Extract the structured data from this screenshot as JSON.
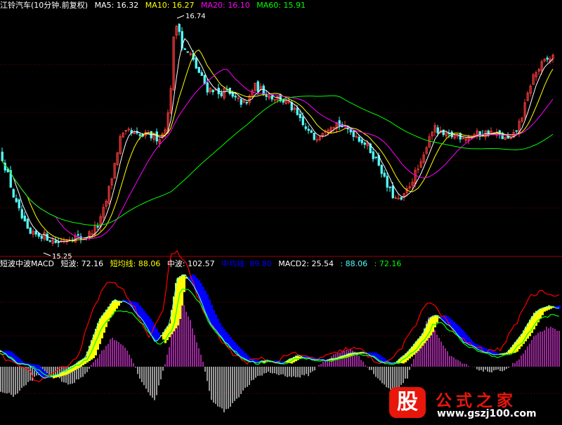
{
  "colors": {
    "background": "#000000",
    "candle_up": "#ff3c3c",
    "candle_down": "#54ffff",
    "ma5": "#ffffff",
    "ma10": "#ffff00",
    "ma20": "#ff00ff",
    "ma60": "#00ff00",
    "short_wave": "#ff0000",
    "short_avg": "#ffff00",
    "mid_wave": "#00ff00",
    "mid_avg": "#0000ff",
    "macd2": "#ffffff",
    "hist_pos": "#ff44ff",
    "hist_neg": "#ffffff",
    "grid": "#7a0000"
  },
  "price_panel": {
    "legend": [
      {
        "text": "江铃汽车(10分钟.前复权)",
        "color": "#ffffff"
      },
      {
        "text": "MA5: 16.32",
        "color": "#ffffff"
      },
      {
        "text": "MA10: 16.27",
        "color": "#ffff00"
      },
      {
        "text": "MA20: 16.10",
        "color": "#ff00ff"
      },
      {
        "text": "MA60: 15.91",
        "color": "#00ff00"
      }
    ],
    "high_label": "16.74",
    "low_label": "15.25"
  },
  "indicator_panel": {
    "legend": [
      {
        "text": "短波中波MACD",
        "color": "#ffffff"
      },
      {
        "text": "短波: 72.16",
        "color": "#ffffff"
      },
      {
        "text": "短均线: 88.06",
        "color": "#ffff00"
      },
      {
        "text": "中波: 102.57",
        "color": "#ffffff"
      },
      {
        "text": "中均线: 89.80",
        "color": "#0000ff"
      },
      {
        "text": "MACD2: 25.54",
        "color": "#ffffff"
      },
      {
        "text": ": 88.06",
        "color": "#54ffff"
      },
      {
        "text": ": 72.16",
        "color": "#00ff00"
      }
    ]
  },
  "watermark": {
    "logo": "股",
    "title": "公式之家",
    "url": "www.gszj100.com"
  },
  "chart_data": [
    {
      "type": "line",
      "title": "江铃汽车(10分钟.前复权)",
      "y_range": [
        15.25,
        16.74
      ],
      "price_anchors": {
        "x": [
          0,
          10,
          20,
          40,
          60,
          80,
          100,
          120,
          140,
          150,
          160,
          170,
          182,
          190,
          198,
          208,
          216,
          225,
          232,
          240,
          246,
          252,
          258,
          264,
          270,
          278,
          286,
          294,
          302,
          310,
          320,
          330,
          340,
          350,
          360,
          372,
          384,
          396,
          410,
          420,
          430,
          440,
          446,
          452,
          460,
          470,
          480,
          490,
          500,
          510,
          520,
          530,
          540,
          548,
          556,
          564,
          572,
          580,
          590,
          600,
          608,
          616,
          624,
          634,
          648,
          660,
          672,
          684,
          696,
          708,
          720,
          726,
          732,
          740,
          748,
          756,
          764,
          772,
          782,
          790
        ],
        "y": [
          15.86,
          15.72,
          15.55,
          15.33,
          15.33,
          15.28,
          15.32,
          15.31,
          15.4,
          15.55,
          15.75,
          15.96,
          16.0,
          15.98,
          15.97,
          15.98,
          15.97,
          15.96,
          16.0,
          16.15,
          16.6,
          16.74,
          16.55,
          16.52,
          16.5,
          16.42,
          16.35,
          16.28,
          16.28,
          16.25,
          16.27,
          16.22,
          16.2,
          16.18,
          16.3,
          16.27,
          16.23,
          16.22,
          16.18,
          16.12,
          16.04,
          15.99,
          15.96,
          15.98,
          16.02,
          16.05,
          16.06,
          16.02,
          16.0,
          15.96,
          15.92,
          15.85,
          15.78,
          15.66,
          15.6,
          15.55,
          15.56,
          15.64,
          15.73,
          15.8,
          15.96,
          16.03,
          15.99,
          15.97,
          15.98,
          15.97,
          15.98,
          15.99,
          16.0,
          15.98,
          15.95,
          15.95,
          15.99,
          16.08,
          16.2,
          16.35,
          16.4,
          16.45,
          16.48,
          16.5
        ]
      },
      "series": [
        {
          "name": "MA5",
          "value": 16.32
        },
        {
          "name": "MA10",
          "value": 16.27
        },
        {
          "name": "MA20",
          "value": 16.1
        },
        {
          "name": "MA60",
          "value": 15.91
        }
      ]
    },
    {
      "type": "bar",
      "title": "短波中波MACD",
      "series": [
        {
          "name": "短波",
          "value": 72.16
        },
        {
          "name": "短均线",
          "value": 88.06
        },
        {
          "name": "中波",
          "value": 102.57
        },
        {
          "name": "中均线",
          "value": 89.8
        },
        {
          "name": "MACD2",
          "value": 25.54
        }
      ],
      "macd2_anchors": {
        "x": [
          0,
          20,
          40,
          60,
          80,
          100,
          120,
          140,
          160,
          180,
          200,
          220,
          240,
          250,
          260,
          270,
          280,
          290,
          300,
          320,
          340,
          360,
          380,
          400,
          420,
          440,
          460,
          480,
          500,
          520,
          540,
          560,
          580,
          600,
          610,
          620,
          640,
          660,
          680,
          700,
          720,
          740,
          760,
          780,
          800
        ],
        "y": [
          -18,
          -22,
          -12,
          -4,
          -8,
          -14,
          -6,
          8,
          22,
          14,
          -10,
          -26,
          12,
          45,
          48,
          36,
          18,
          2,
          -24,
          -34,
          -22,
          -10,
          -4,
          -6,
          -8,
          -6,
          4,
          10,
          14,
          2,
          -10,
          -20,
          -8,
          24,
          38,
          26,
          8,
          2,
          -2,
          -4,
          -2,
          6,
          22,
          30,
          25
        ]
      },
      "line_anchors": {
        "x": [
          0,
          20,
          40,
          60,
          80,
          100,
          120,
          140,
          160,
          180,
          200,
          220,
          240,
          250,
          260,
          270,
          280,
          290,
          300,
          320,
          340,
          360,
          380,
          400,
          420,
          440,
          460,
          480,
          500,
          520,
          540,
          560,
          580,
          600,
          610,
          620,
          640,
          660,
          680,
          700,
          720,
          740,
          760,
          780,
          800
        ],
        "y": [
          20,
          5,
          2,
          -15,
          -10,
          0,
          12,
          60,
          85,
          82,
          60,
          30,
          55,
          112,
          118,
          108,
          92,
          70,
          52,
          30,
          12,
          5,
          8,
          4,
          14,
          10,
          8,
          12,
          18,
          18,
          6,
          4,
          20,
          42,
          62,
          66,
          50,
          30,
          22,
          15,
          18,
          40,
          70,
          78,
          72
        ]
      }
    }
  ]
}
